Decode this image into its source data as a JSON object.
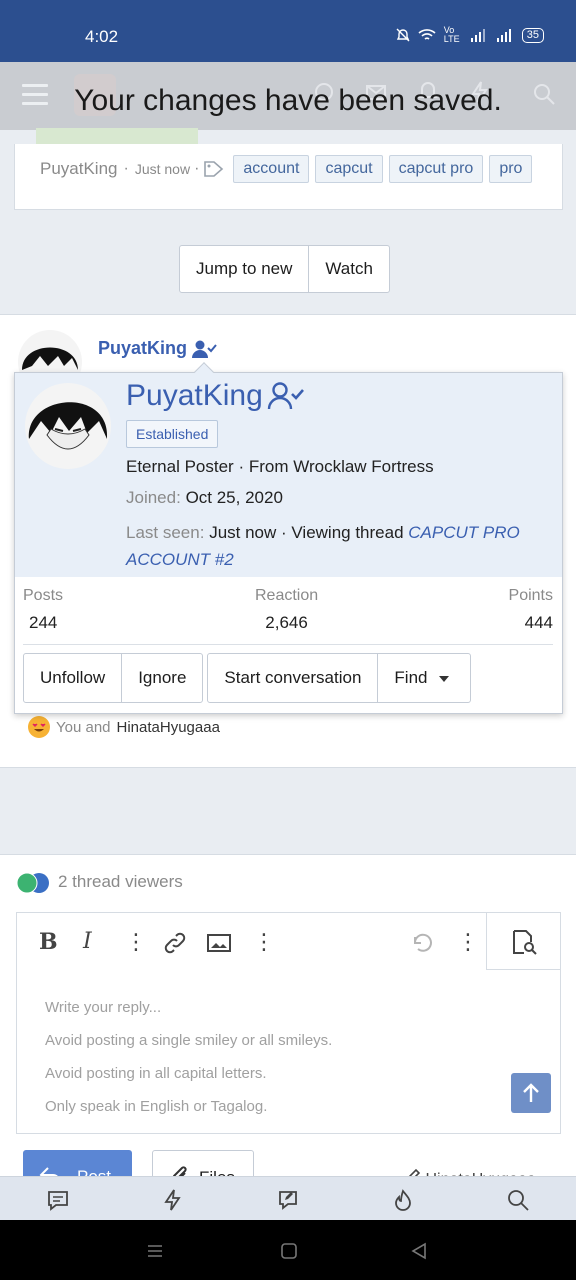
{
  "status_bar": {
    "time": "4:02",
    "network": "Vo LTE",
    "battery": "35"
  },
  "toast": {
    "message": "Your changes have been saved."
  },
  "thread_meta": {
    "author": "PuyatKing",
    "time": "Just now",
    "tags": [
      "account",
      "capcut",
      "capcut pro",
      "pro"
    ]
  },
  "thread_actions": {
    "jump_to_new": "Jump to new",
    "watch": "Watch"
  },
  "post": {
    "author": "PuyatKing",
    "likes_prefix": "You and",
    "likes_user": "HinataHyugaaa"
  },
  "member_tooltip": {
    "username": "PuyatKing",
    "badge": "Established",
    "user_title": "Eternal Poster · From Wrocklaw Fortress",
    "joined_label": "Joined:",
    "joined_value": "Oct 25, 2020",
    "last_seen_label": "Last seen:",
    "last_seen_value": "Just now · Viewing thread",
    "last_seen_link": "CAPCUT PRO ACCOUNT #2",
    "stats": [
      {
        "label": "Posts",
        "value": "244"
      },
      {
        "label": "Reaction",
        "value": "2,646"
      },
      {
        "label": "Points",
        "value": "444"
      }
    ],
    "buttons": {
      "unfollow": "Unfollow",
      "ignore": "Ignore",
      "start_conversation": "Start conversation",
      "find": "Find"
    }
  },
  "thread_viewers": {
    "label": "2 thread viewers",
    "colors": [
      "#3cb371",
      "#3a6fc4"
    ]
  },
  "editor": {
    "placeholder_lines": [
      "Write your reply...",
      "Avoid posting a single smiley or all smileys.",
      "Avoid posting in all capital letters.",
      "Only speak in English or Tagalog."
    ],
    "post_button": "Post",
    "files_button": "Files",
    "reply_to": "HinataHyugaaa"
  },
  "colors": {
    "brand": "#2c4f8f",
    "accent": "#3a5fb0",
    "post_button": "#5b86d4"
  }
}
